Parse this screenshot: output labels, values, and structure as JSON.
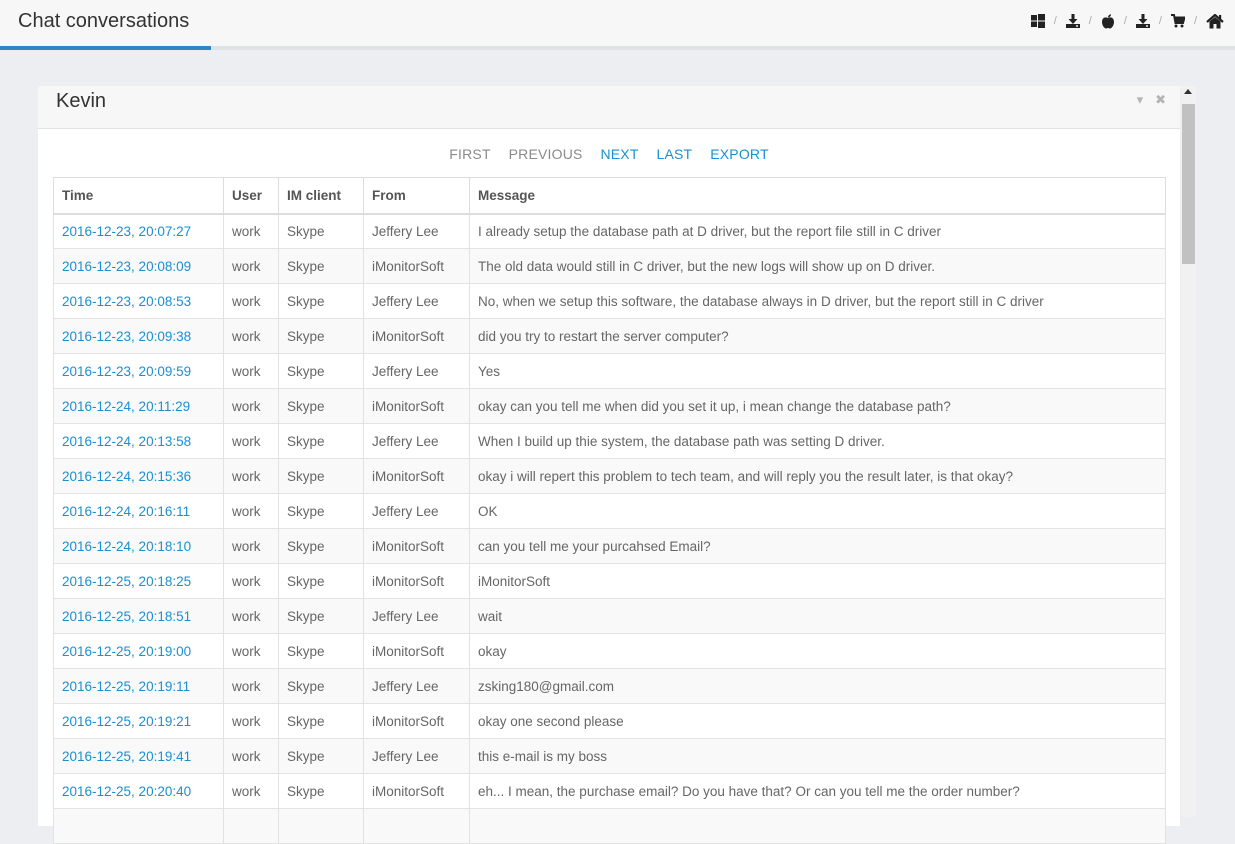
{
  "header": {
    "title": "Chat conversations",
    "icons": [
      "windows-icon",
      "download-icon",
      "apple-icon",
      "download-icon",
      "cart-icon",
      "home-icon"
    ],
    "separator": "/"
  },
  "panel": {
    "title": "Kevin",
    "collapse_glyph": "▾",
    "close_glyph": "✖"
  },
  "pager": {
    "first": "FIRST",
    "previous": "PREVIOUS",
    "next": "NEXT",
    "last": "LAST",
    "export": "EXPORT"
  },
  "table": {
    "columns": [
      "Time",
      "User",
      "IM client",
      "From",
      "Message"
    ],
    "rows": [
      [
        "2016-12-23, 20:07:27",
        "work",
        "Skype",
        "Jeffery Lee",
        "I already setup the database path at D driver, but the report file still in C driver"
      ],
      [
        "2016-12-23, 20:08:09",
        "work",
        "Skype",
        "iMonitorSoft",
        "The old data would still in C driver, but the new logs will show up on D driver."
      ],
      [
        "2016-12-23, 20:08:53",
        "work",
        "Skype",
        "Jeffery Lee",
        "No, when we setup this software, the database always in D driver, but the report still in C driver"
      ],
      [
        "2016-12-23, 20:09:38",
        "work",
        "Skype",
        "iMonitorSoft",
        "did you try to restart the server computer?"
      ],
      [
        "2016-12-23, 20:09:59",
        "work",
        "Skype",
        "Jeffery Lee",
        "Yes"
      ],
      [
        "2016-12-24, 20:11:29",
        "work",
        "Skype",
        "iMonitorSoft",
        "okay can you tell me when did you set it up, i mean change the database path?"
      ],
      [
        "2016-12-24, 20:13:58",
        "work",
        "Skype",
        "Jeffery Lee",
        "When I build up thie system, the database path was setting D driver."
      ],
      [
        "2016-12-24, 20:15:36",
        "work",
        "Skype",
        "iMonitorSoft",
        "okay i will repert this problem to tech team, and will reply you the result later, is that okay?"
      ],
      [
        "2016-12-24, 20:16:11",
        "work",
        "Skype",
        "Jeffery Lee",
        "OK"
      ],
      [
        "2016-12-24, 20:18:10",
        "work",
        "Skype",
        "iMonitorSoft",
        "can you tell me your purcahsed Email?"
      ],
      [
        "2016-12-25, 20:18:25",
        "work",
        "Skype",
        "iMonitorSoft",
        "iMonitorSoft"
      ],
      [
        "2016-12-25, 20:18:51",
        "work",
        "Skype",
        "Jeffery Lee",
        "wait"
      ],
      [
        "2016-12-25, 20:19:00",
        "work",
        "Skype",
        "iMonitorSoft",
        "okay"
      ],
      [
        "2016-12-25, 20:19:11",
        "work",
        "Skype",
        "Jeffery Lee",
        "zsking180@gmail.com"
      ],
      [
        "2016-12-25, 20:19:21",
        "work",
        "Skype",
        "iMonitorSoft",
        "okay one second please"
      ],
      [
        "2016-12-25, 20:19:41",
        "work",
        "Skype",
        "Jeffery Lee",
        "this e-mail is my boss"
      ],
      [
        "2016-12-25, 20:20:40",
        "work",
        "Skype",
        "iMonitorSoft",
        "eh... I mean, the purchase email? Do you have that? Or can you tell me the order number?"
      ],
      [
        "",
        "",
        "",
        "",
        ""
      ]
    ]
  },
  "colors": {
    "accent": "#2d87c6",
    "link": "#1b8fd1"
  }
}
